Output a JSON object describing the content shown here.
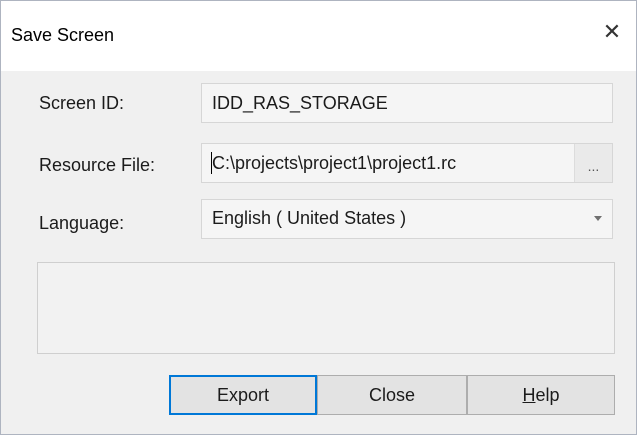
{
  "window": {
    "title": "Save Screen",
    "close_glyph": "✕"
  },
  "form": {
    "screen_id": {
      "label": "Screen ID:",
      "value": "IDD_RAS_STORAGE"
    },
    "resource_file": {
      "label": "Resource File:",
      "value": "C:\\projects\\project1\\project1.rc",
      "browse_label": "..."
    },
    "language": {
      "label": "Language:",
      "value": "English ( United States )"
    }
  },
  "buttons": {
    "export": "Export",
    "close": "Close",
    "help_mnemonic": "H",
    "help_rest": "elp"
  },
  "colors": {
    "accent": "#0078d7",
    "dialog_bg": "#f0f0f0",
    "titlebar_bg": "#ffffff"
  }
}
